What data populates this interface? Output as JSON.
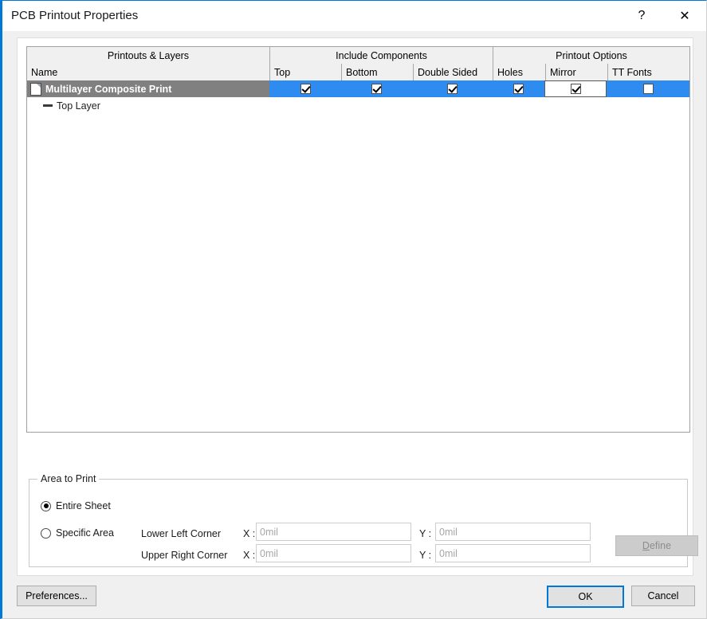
{
  "window": {
    "title": "PCB Printout Properties",
    "help_icon": "?",
    "close_icon": "✕"
  },
  "table": {
    "group_headers": [
      {
        "label": "Printouts & Layers"
      },
      {
        "label": "Include Components"
      },
      {
        "label": "Printout Options"
      }
    ],
    "columns": [
      {
        "label": "Name"
      },
      {
        "label": "Top"
      },
      {
        "label": "Bottom"
      },
      {
        "label": "Double Sided"
      },
      {
        "label": "Holes"
      },
      {
        "label": "Mirror"
      },
      {
        "label": "TT Fonts"
      }
    ],
    "rows": [
      {
        "name": "Multilayer Composite Print",
        "selected": true,
        "icon": "page-icon",
        "top": true,
        "bottom": true,
        "double_sided": true,
        "holes": true,
        "mirror": true,
        "mirror_focused": true,
        "tt_fonts": false
      }
    ],
    "child_rows": [
      {
        "name": "Top Layer",
        "icon": "dash-icon"
      }
    ],
    "selection_color": "#2e8cf0",
    "name_selection_color": "#808080"
  },
  "area_to_print": {
    "legend": "Area to Print",
    "options": [
      {
        "label": "Entire Sheet",
        "selected": true
      },
      {
        "label": "Specific Area",
        "selected": false
      }
    ],
    "fields": [
      {
        "row_label": "Lower Left Corner",
        "x_label": "X :",
        "x_value": "0mil",
        "y_label": "Y :",
        "y_value": "0mil"
      },
      {
        "row_label": "Upper Right Corner",
        "x_label": "X :",
        "x_value": "0mil",
        "y_label": "Y :",
        "y_value": "0mil"
      }
    ],
    "define_button": {
      "label": "Define",
      "accelerator": "D",
      "enabled": false
    }
  },
  "footer": {
    "preferences_label": "Preferences...",
    "ok_label": "OK",
    "cancel_label": "Cancel"
  }
}
